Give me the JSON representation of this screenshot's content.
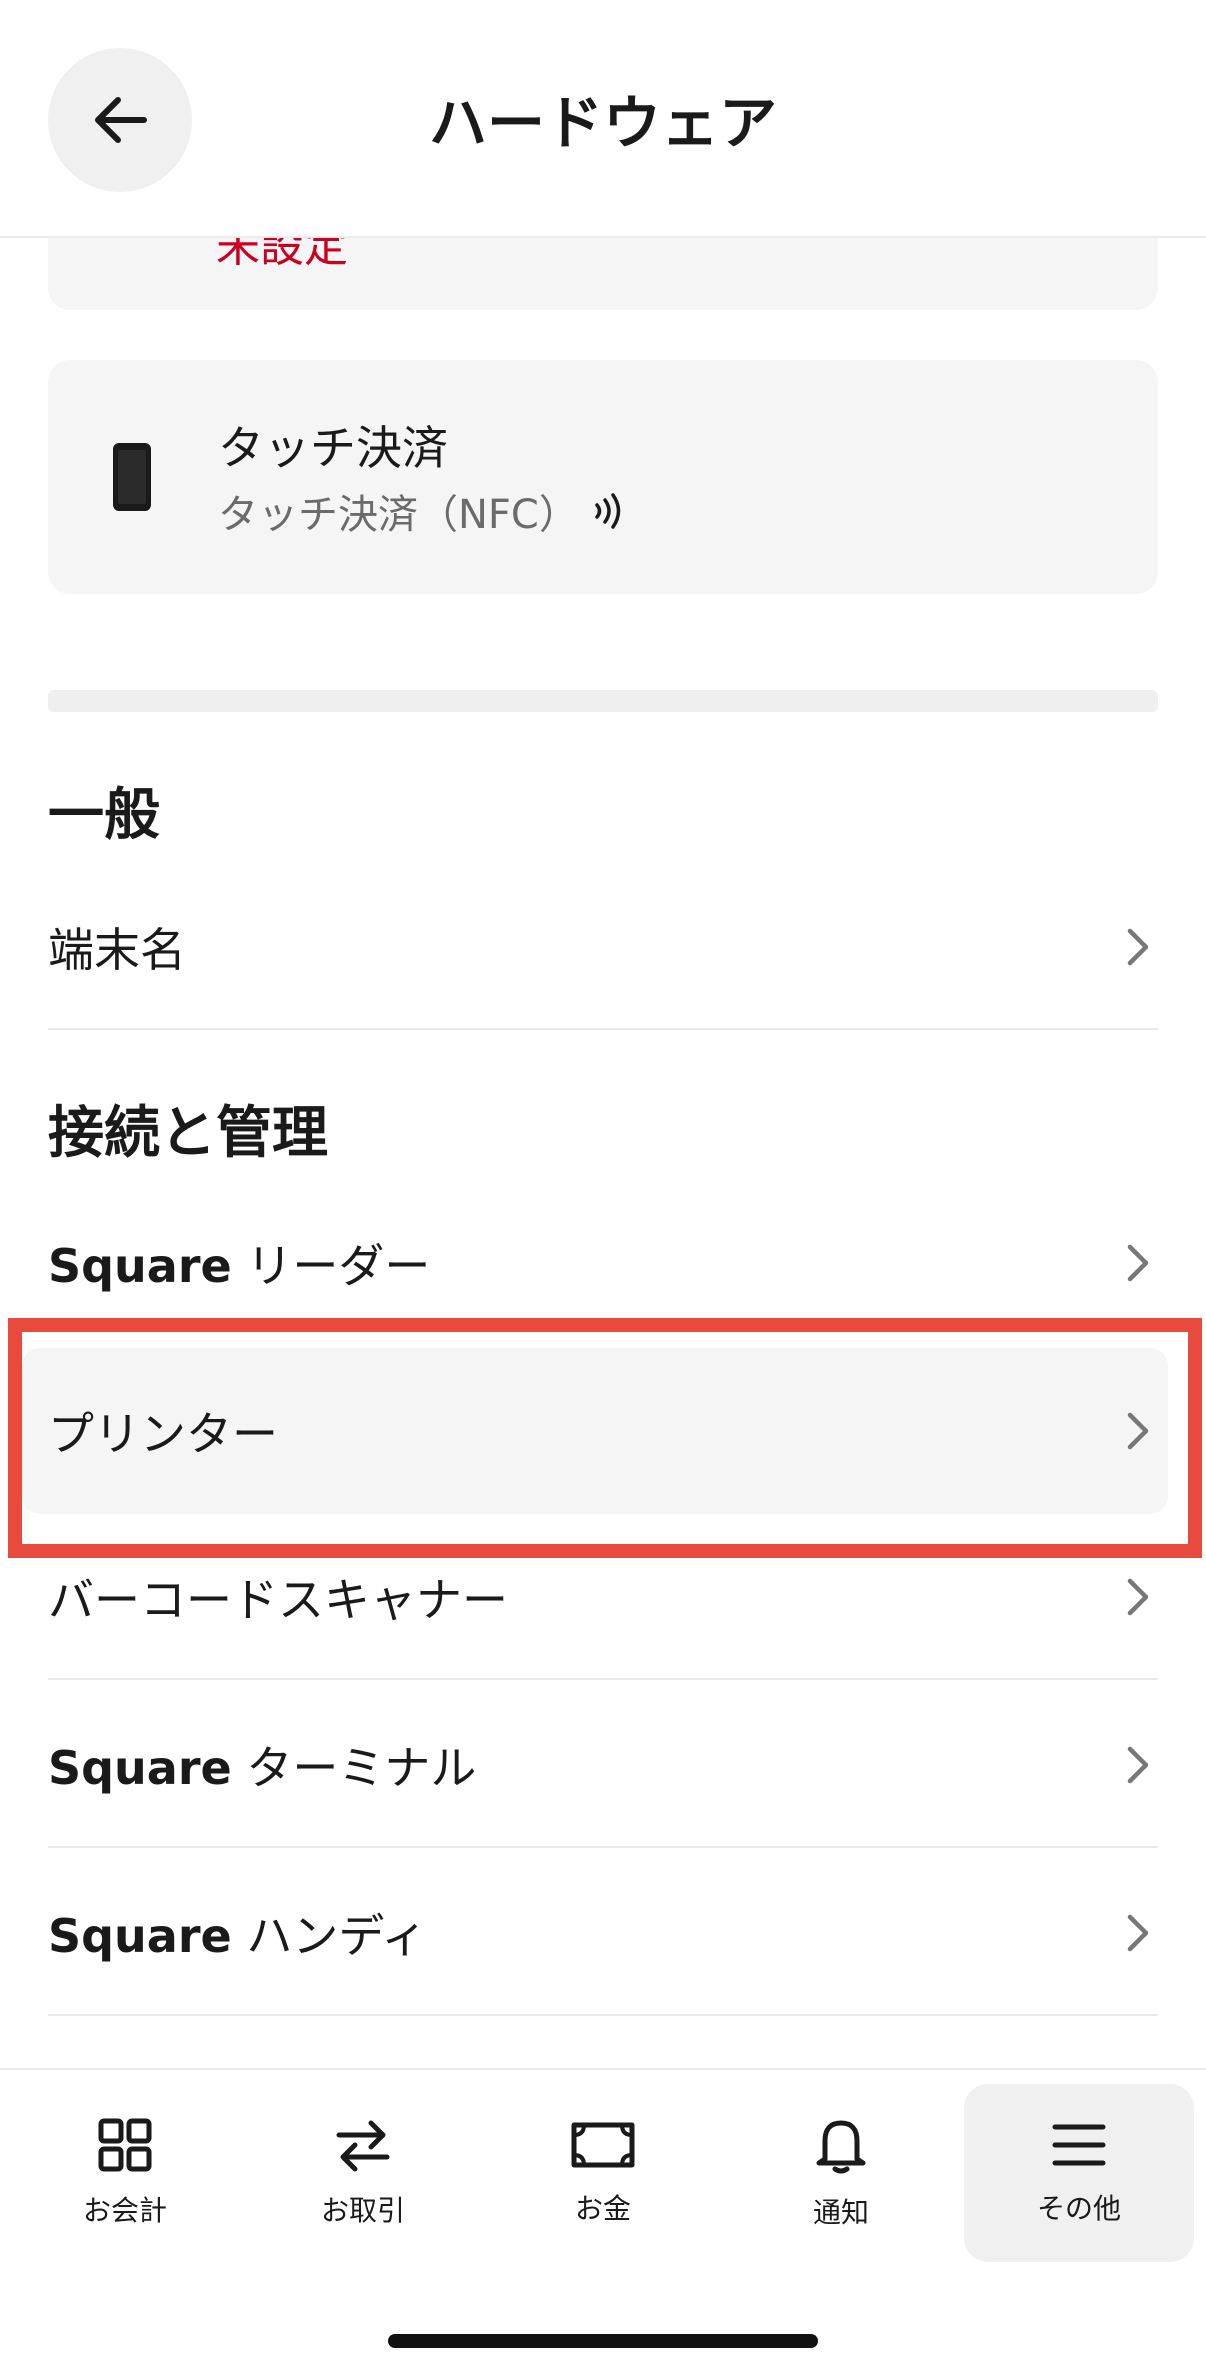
{
  "header": {
    "title": "ハードウェア"
  },
  "top_card": {
    "status_partial": "未設定"
  },
  "tap_card": {
    "title": "タッチ決済",
    "subtitle": "タッチ決済（NFC）"
  },
  "sections": {
    "general": {
      "heading": "一般",
      "items": [
        {
          "label": "端末名"
        }
      ]
    },
    "connection": {
      "heading": "接続と管理",
      "items": [
        {
          "brand": "Square",
          "label": "リーダー"
        },
        {
          "label": "プリンター"
        },
        {
          "label": "バーコードスキャナー"
        },
        {
          "brand": "Square",
          "label": "ターミナル"
        },
        {
          "brand": "Square",
          "label": "ハンディ"
        }
      ]
    }
  },
  "bottom_nav": [
    {
      "label": "お会計",
      "icon": "grid-icon"
    },
    {
      "label": "お取引",
      "icon": "transfer-arrows-icon"
    },
    {
      "label": "お金",
      "icon": "money-icon"
    },
    {
      "label": "通知",
      "icon": "bell-icon"
    },
    {
      "label": "その他",
      "icon": "menu-icon",
      "active": true
    }
  ],
  "colors": {
    "accent_red": "#cc0023",
    "annotation_red": "#e84a3d"
  }
}
